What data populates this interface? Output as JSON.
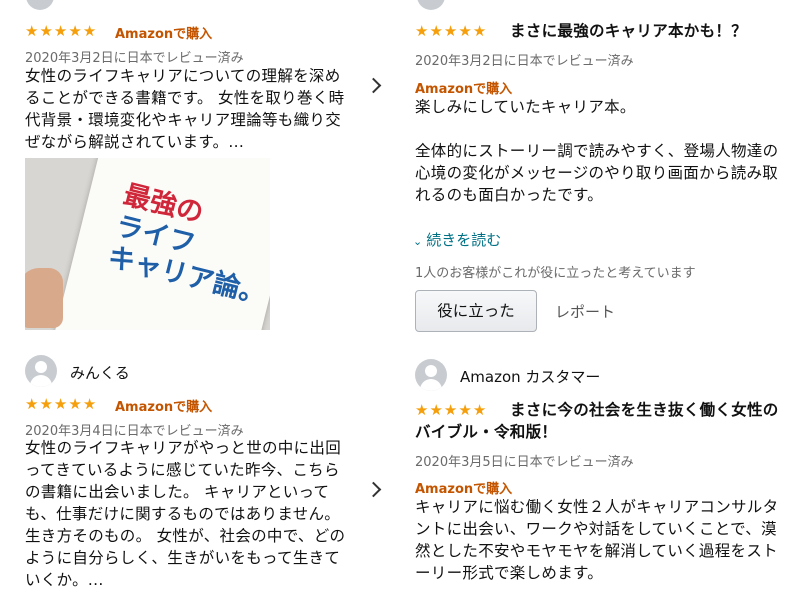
{
  "left_panel": {
    "review1": {
      "stars": 5,
      "verified_label": "Amazonで購入",
      "date": "2020年3月2日に日本でレビュー済み",
      "body": "女性のライフキャリアについての理解を深め\nることができる書籍です。 女性を取り巻く時\n代背景・環境変化やキャリア理論等も織り交\nぜながら解説されています。...",
      "image": {
        "book_title_line1": "最強の",
        "book_title_line2": "ライフ",
        "book_title_line3": "キャリア論。"
      }
    },
    "review2": {
      "reviewer_name": "みんくる",
      "stars": 5,
      "verified_label": "Amazonで購入",
      "date": "2020年3月4日に日本でレビュー済み",
      "body": "女性のライフキャリアがやっと世の中に出回\nってきているように感じていた昨今、こちら\nの書籍に出会いました。 キャリアといって\nも、仕事だけに関するものではありません。\n生き方そのもの。 女性が、社会の中で、どの\nように自分らしく、生きがいをもって生きて\nいくか。..."
    }
  },
  "right_panel": {
    "review1": {
      "stars": 5,
      "title": "まさに最強のキャリア本かも！？",
      "date": "2020年3月2日に日本でレビュー済み",
      "verified_label": "Amazonで購入",
      "body": "楽しみにしていたキャリア本。\n\n全体的にストーリー調で読みやすく、登場人物達の\n心境の変化がメッセージのやり取り画面から読み取\nれるのも面白かったです。",
      "read_more": "続きを読む",
      "helpful_count": "1人のお客様がこれが役に立ったと考えています",
      "helpful_button": "役に立った",
      "report_link": "レポート"
    },
    "review2": {
      "reviewer_name": "Amazon カスタマー",
      "stars": 5,
      "title_line1": "まさに今の社会を生き抜く働く女性の",
      "title_line2": "バイブル・令和版！",
      "date": "2020年3月5日に日本でレビュー済み",
      "verified_label": "Amazonで購入",
      "body": "キャリアに悩む働く女性２人がキャリアコンサルタ\nントに出会い、ワークや対話をしていくことで、漠\n然とした不安やモヤモヤを解消していく過程をスト\nーリー形式で楽しめます。"
    }
  },
  "colors": {
    "star": "#f59f0c",
    "verified": "#c45500",
    "link": "#007185",
    "muted": "#6a6a6a"
  }
}
